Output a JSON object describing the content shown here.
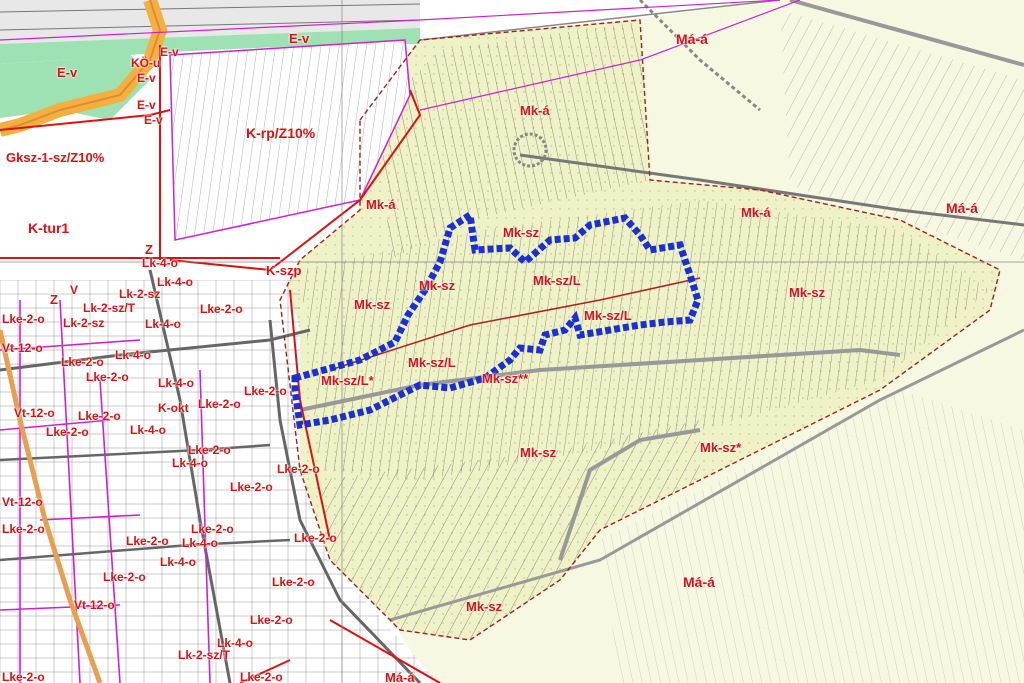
{
  "map": {
    "label_color": "#e01010",
    "highlight_color": "#1a2fd6",
    "colors": {
      "development_area": "#eef2c6",
      "green_strip": "#9ee2b4",
      "road_orange": "#f2b040",
      "cadastre_line": "#2a2a2a",
      "boundary_dash": "#a02020",
      "pink_line": "#d020d0"
    },
    "labels": [
      {
        "text": "E-v"
      },
      {
        "text": "KÖ-u"
      },
      {
        "text": "E-v"
      },
      {
        "text": "E-v"
      },
      {
        "text": "E-v"
      },
      {
        "text": "E-v"
      },
      {
        "text": "E-v"
      },
      {
        "text": "Gksz-1-sz/Z10%"
      },
      {
        "text": "K-tur1"
      },
      {
        "text": "K-rp/Z10%"
      },
      {
        "text": "Má-á"
      },
      {
        "text": "Mk-á"
      },
      {
        "text": "Mk-á"
      },
      {
        "text": "Mk-á"
      },
      {
        "text": "Má-á"
      },
      {
        "text": "Mk-sz"
      },
      {
        "text": "Mk-sz/L"
      },
      {
        "text": "Mk-sz"
      },
      {
        "text": "Mk-sz/L"
      },
      {
        "text": "Mk-sz"
      },
      {
        "text": "Mk-sz"
      },
      {
        "text": "Mk-sz/L"
      },
      {
        "text": "Mk-sz/L*"
      },
      {
        "text": "Mk-sz**"
      },
      {
        "text": "Mk-sz"
      },
      {
        "text": "Mk-sz*"
      },
      {
        "text": "Má-á"
      },
      {
        "text": "Mk-sz"
      },
      {
        "text": "K-szp"
      },
      {
        "text": "Z"
      },
      {
        "text": "Lk-4-o"
      },
      {
        "text": "Lk-4-o"
      },
      {
        "text": "Z"
      },
      {
        "text": "V"
      },
      {
        "text": "Lk-2-sz"
      },
      {
        "text": "Lk-2-sz/T"
      },
      {
        "text": "Lke-2-o"
      },
      {
        "text": "Lk-2-sz"
      },
      {
        "text": "Lk-4-o"
      },
      {
        "text": "Lke-2-o"
      },
      {
        "text": "Vt-12-o"
      },
      {
        "text": "Lk-4-o"
      },
      {
        "text": "Lke-2-o"
      },
      {
        "text": "Lke-2-o"
      },
      {
        "text": "Lk-4-o"
      },
      {
        "text": "Lke-2-o"
      },
      {
        "text": "Vt-12-o"
      },
      {
        "text": "Lke-2-o"
      },
      {
        "text": "K-okt"
      },
      {
        "text": "Lke-2-o"
      },
      {
        "text": "Lke-2-o"
      },
      {
        "text": "Lk-4-o"
      },
      {
        "text": "Lke-2-o"
      },
      {
        "text": "Lk-4-o"
      },
      {
        "text": "Lke-2-o"
      },
      {
        "text": "Lke-2-o"
      },
      {
        "text": "Vt-12-o"
      },
      {
        "text": "Lke-2-o"
      },
      {
        "text": "Lke-2-o"
      },
      {
        "text": "Lke-2-o"
      },
      {
        "text": "Lk-4-o"
      },
      {
        "text": "Lke-2-o"
      },
      {
        "text": "Lk-4-o"
      },
      {
        "text": "Lke-2-o"
      },
      {
        "text": "Lke-2-o"
      },
      {
        "text": "Vt-12-o"
      },
      {
        "text": "Lke-2-o"
      },
      {
        "text": "Lk-4-o"
      },
      {
        "text": "Lk-2-sz/T"
      },
      {
        "text": "Má-á"
      },
      {
        "text": "Lke-2-o"
      },
      {
        "text": "Lke-2-o"
      }
    ]
  }
}
